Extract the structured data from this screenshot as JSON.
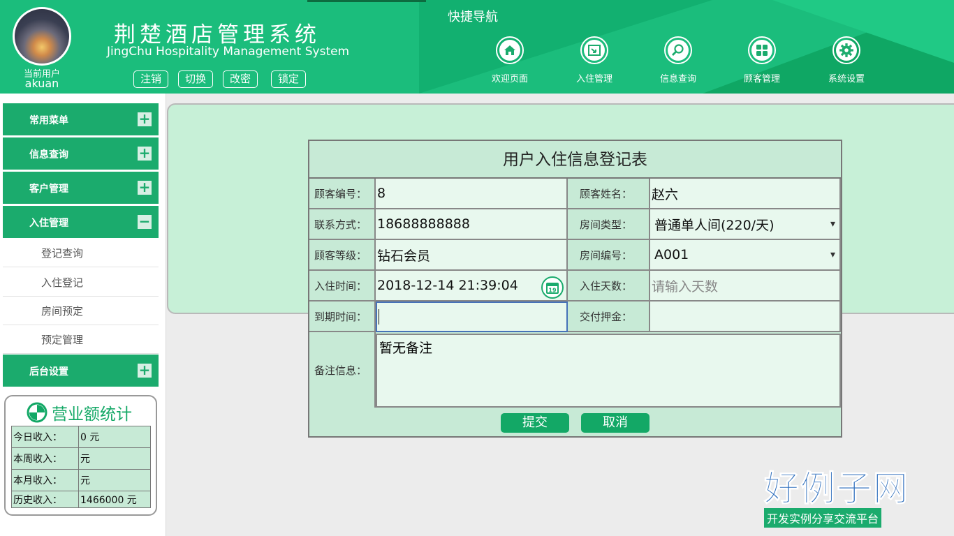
{
  "header": {
    "user_label": "当前用户",
    "user_name": "akuan",
    "title_cn": "荆楚酒店管理系统",
    "title_en": "JingChu Hospitality Management System",
    "buttons": [
      "注销",
      "切换",
      "改密",
      "锁定"
    ],
    "quick_nav_title": "快捷导航",
    "nav": [
      {
        "label": "欢迎页面",
        "icon": "home-icon"
      },
      {
        "label": "入住管理",
        "icon": "checkin-icon"
      },
      {
        "label": "信息查询",
        "icon": "search-icon"
      },
      {
        "label": "顾客管理",
        "icon": "grid-icon"
      },
      {
        "label": "系统设置",
        "icon": "gear-icon"
      }
    ]
  },
  "sidebar": {
    "menus": [
      {
        "label": "常用菜单",
        "toggle": "+"
      },
      {
        "label": "信息查询",
        "toggle": "+"
      },
      {
        "label": "客户管理",
        "toggle": "+"
      },
      {
        "label": "入住管理",
        "toggle": "−"
      },
      {
        "label": "后台设置",
        "toggle": "+"
      }
    ],
    "submenu": [
      "登记查询",
      "入住登记",
      "房间预定",
      "预定管理"
    ],
    "stats": {
      "title": "营业额统计",
      "rows": [
        {
          "k": "今日收入：",
          "v": "0 元"
        },
        {
          "k": "本周收入：",
          "v": "元"
        },
        {
          "k": "本月收入：",
          "v": "元"
        },
        {
          "k": "历史收入：",
          "v": "1466000 元"
        }
      ]
    }
  },
  "form": {
    "title": "用户入住信息登记表",
    "fields": {
      "customer_id_label": "顾客编号：",
      "customer_id_value": "8",
      "customer_name_label": "顾客姓名：",
      "customer_name_value": "赵六",
      "contact_label": "联系方式：",
      "contact_value": "18688888888",
      "room_type_label": "房间类型：",
      "room_type_value": "普通单人间(220/天)",
      "level_label": "顾客等级：",
      "level_value": "钻石会员",
      "room_no_label": "房间编号：",
      "room_no_value": "A001",
      "checkin_time_label": "入住时间：",
      "checkin_time_value": "2018-12-14 21:39:04",
      "calendar_day": "19",
      "days_label": "入住天数：",
      "days_placeholder": "请输入天数",
      "due_time_label": "到期时间：",
      "due_time_value": "",
      "deposit_label": "交付押金：",
      "deposit_value": "",
      "remark_label": "备注信息：",
      "remark_value": "暂无备注"
    },
    "submit_label": "提交",
    "cancel_label": "取消"
  },
  "watermark": {
    "brand": "好例子网",
    "slogan": "开发实例分享交流平台"
  }
}
